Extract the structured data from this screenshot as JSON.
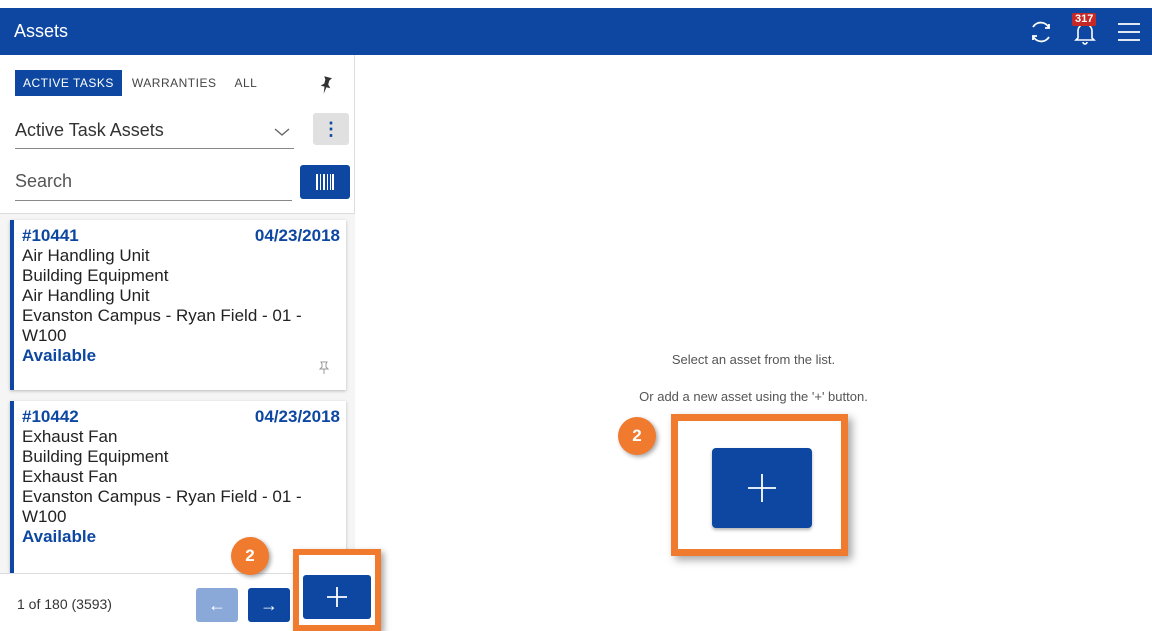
{
  "header": {
    "title": "Assets",
    "notification_count": "317",
    "icons": [
      "sync-icon",
      "bell-icon",
      "menu-icon"
    ]
  },
  "sidebar": {
    "tabs": [
      {
        "label": "ACTIVE TASKS",
        "active": true
      },
      {
        "label": "WARRANTIES",
        "active": false
      },
      {
        "label": "ALL",
        "active": false
      }
    ],
    "filter": {
      "selected": "Active Task Assets"
    },
    "search": {
      "placeholder": "Search"
    },
    "items": [
      {
        "id": "#10441",
        "date": "04/23/2018",
        "name": "Air Handling Unit",
        "category": "Building Equipment",
        "type": "Air Handling Unit",
        "location": "Evanston Campus - Ryan Field - 01 -",
        "location2": "W100",
        "status": "Available"
      },
      {
        "id": "#10442",
        "date": "04/23/2018",
        "name": "Exhaust Fan",
        "category": "Building Equipment",
        "type": "Exhaust Fan",
        "location": "Evanston Campus - Ryan Field - 01 -",
        "location2": "W100",
        "status": "Available"
      }
    ],
    "footer": {
      "pager": "1 of 180 (3593)"
    }
  },
  "main": {
    "message1": "Select an asset from the list.",
    "message2": "Or add a new asset using the '+' button."
  },
  "callouts": {
    "step_small": "2",
    "step_big": "2"
  },
  "colors": {
    "primary": "#0d47a1",
    "highlight": "#f07a2e",
    "badge": "#c62828"
  }
}
